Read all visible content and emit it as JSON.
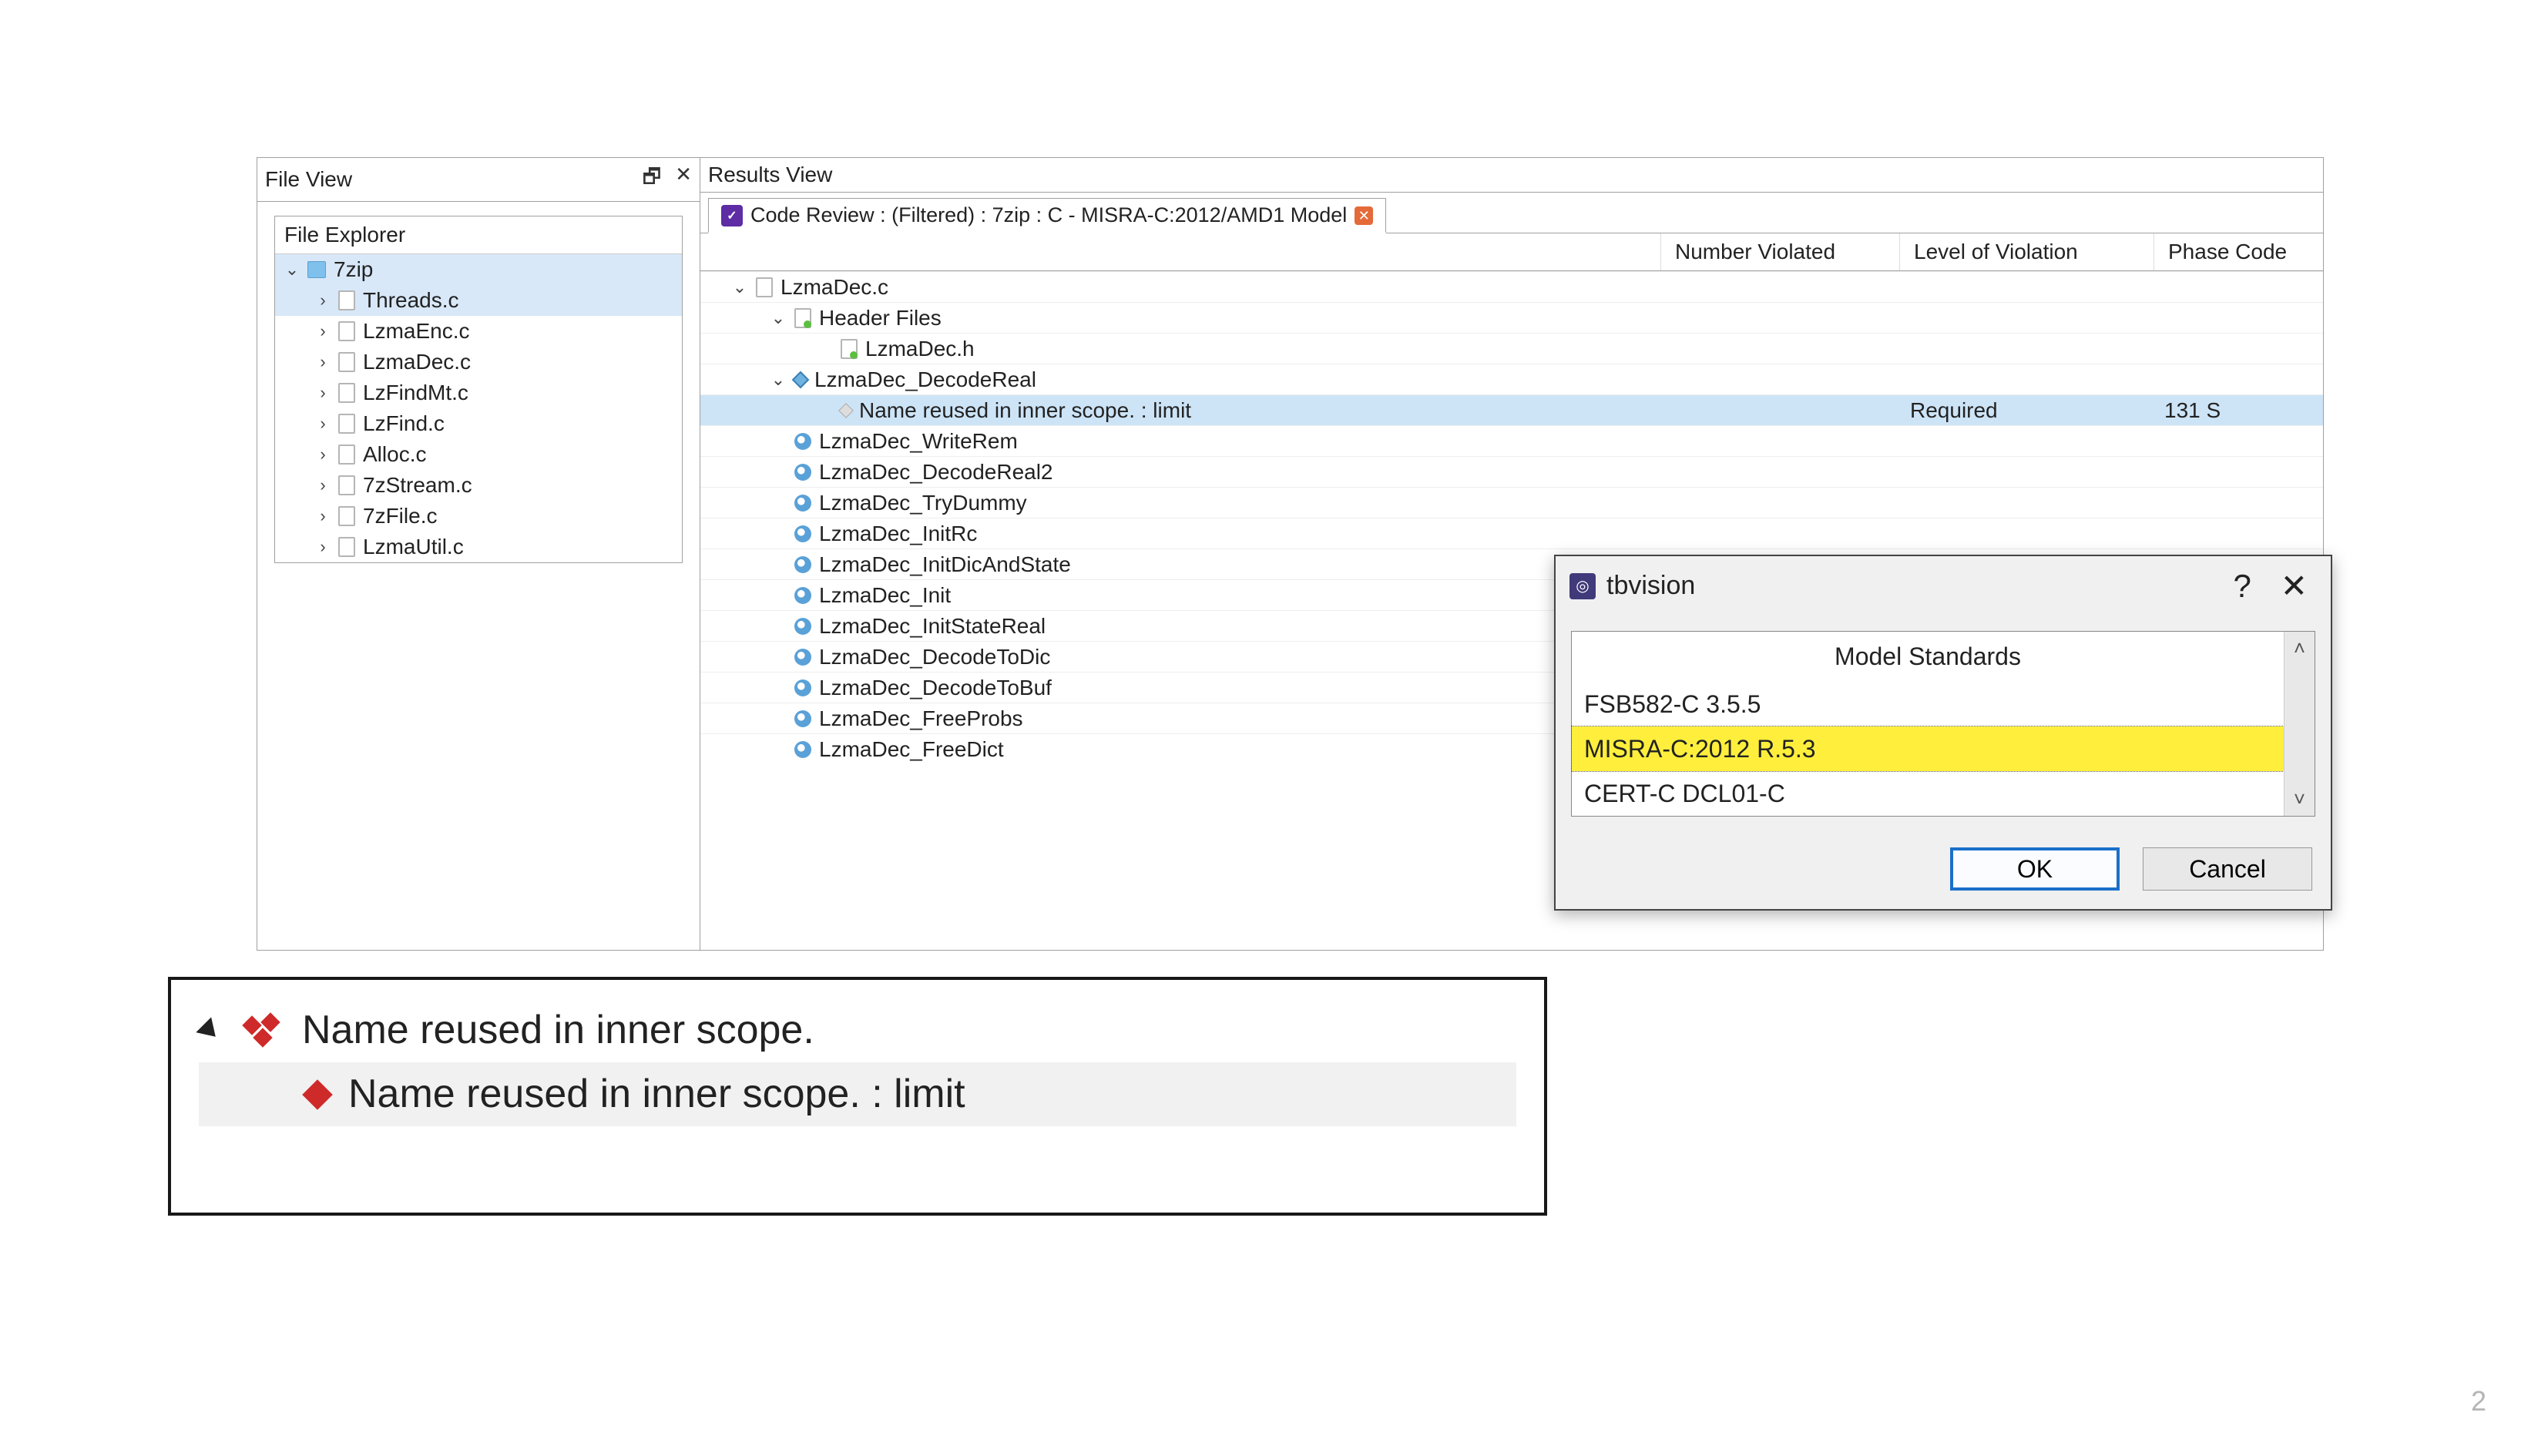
{
  "fileview": {
    "title": "File View",
    "explorer_title": "File Explorer",
    "root": "7zip",
    "files": [
      "Threads.c",
      "LzmaEnc.c",
      "LzmaDec.c",
      "LzFindMt.c",
      "LzFind.c",
      "Alloc.c",
      "7zStream.c",
      "7zFile.c",
      "LzmaUtil.c"
    ]
  },
  "resultsview": {
    "title": "Results View",
    "tab_label": "Code Review : (Filtered) : 7zip : C - MISRA-C:2012/AMD1 Model",
    "columns": {
      "number_violated": "Number Violated",
      "level": "Level of Violation",
      "phase": "Phase Code"
    },
    "tree": {
      "file": "LzmaDec.c",
      "header_section": "Header Files",
      "header_file": "LzmaDec.h",
      "func_selected": "LzmaDec_DecodeReal",
      "violation": {
        "text": "Name reused in inner scope. : limit",
        "number_violated": "",
        "level": "Required",
        "phase": "131 S"
      },
      "funcs": [
        "LzmaDec_WriteRem",
        "LzmaDec_DecodeReal2",
        "LzmaDec_TryDummy",
        "LzmaDec_InitRc",
        "LzmaDec_InitDicAndState",
        "LzmaDec_Init",
        "LzmaDec_InitStateReal",
        "LzmaDec_DecodeToDic",
        "LzmaDec_DecodeToBuf",
        "LzmaDec_FreeProbs",
        "LzmaDec_FreeDict"
      ]
    }
  },
  "dialog": {
    "app": "tbvision",
    "heading": "Model Standards",
    "items": [
      "FSB582-C 3.5.5",
      "MISRA-C:2012 R.5.3",
      "CERT-C DCL01-C"
    ],
    "highlight_index": 1,
    "ok": "OK",
    "cancel": "Cancel"
  },
  "detail": {
    "line1": "Name reused in inner scope.",
    "line2": "Name reused in inner scope. : limit"
  },
  "page_number": "2"
}
